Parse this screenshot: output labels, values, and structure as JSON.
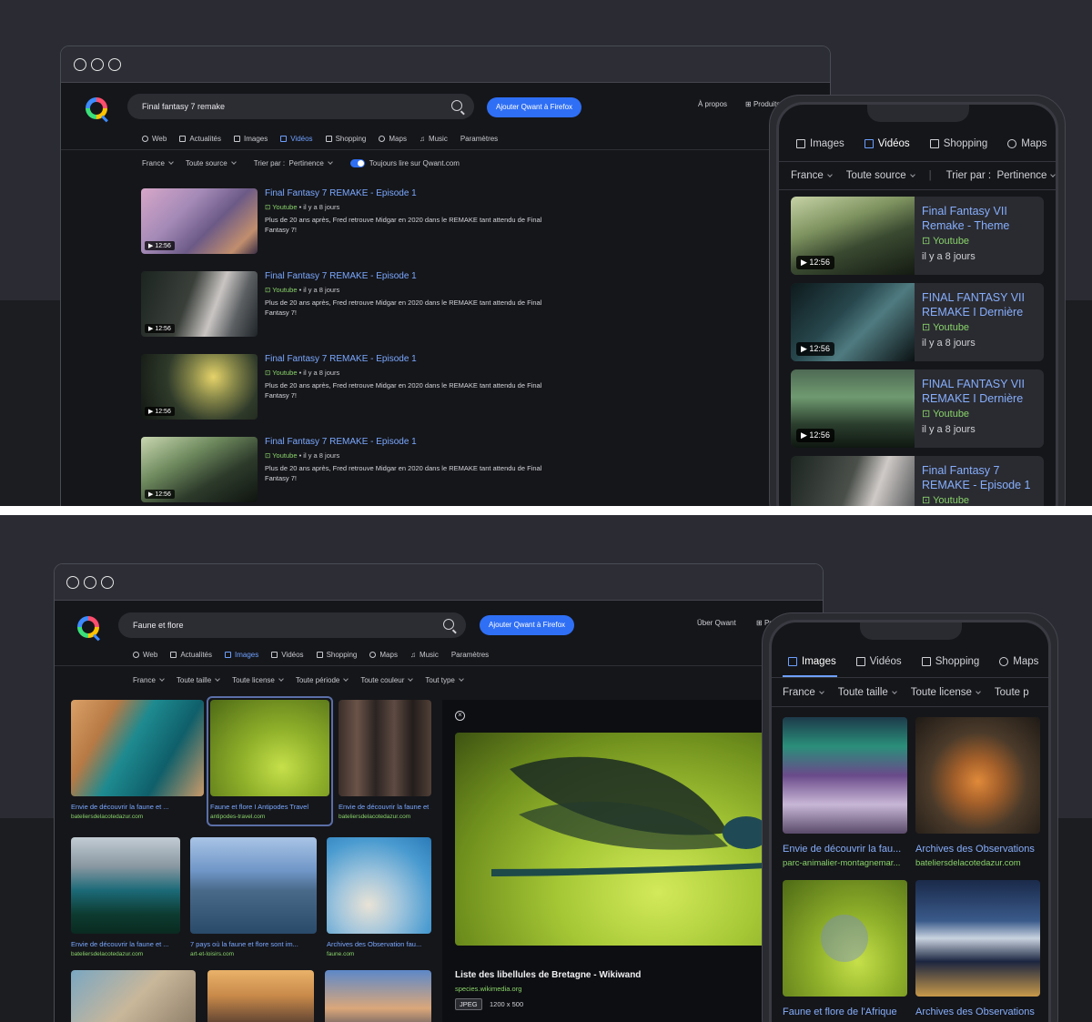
{
  "top": {
    "search": {
      "query": "Final fantasy 7 remake"
    },
    "firefox_button": "Ajouter Qwant à Firefox",
    "links": {
      "about": "À propos",
      "products": "Produits"
    },
    "tabs": [
      "Web",
      "Actualités",
      "Images",
      "Vidéos",
      "Shopping",
      "Maps",
      "Music",
      "Paramètres"
    ],
    "active_tab": "Vidéos",
    "filters": {
      "region": "France",
      "source": "Toute source",
      "sort_label": "Trier par :",
      "sort_value": "Pertinence",
      "toggle_label": "Toujours lire sur Qwant.com"
    },
    "results": [
      {
        "title": "Final Fantasy 7 REMAKE - Episode 1",
        "source": "Youtube",
        "meta": " • il y a 8 jours",
        "desc": "Plus de 20 ans après, Fred retrouve Midgar en 2020 dans le REMAKE tant attendu de Final Fantasy 7!",
        "duration": "▶ 12:56"
      },
      {
        "title": "Final Fantasy 7 REMAKE - Episode 1",
        "source": "Youtube",
        "meta": " • il y a 8 jours",
        "desc": "Plus de 20 ans après, Fred retrouve Midgar en 2020 dans le REMAKE tant attendu de Final Fantasy 7!",
        "duration": "▶ 12:56"
      },
      {
        "title": "Final Fantasy 7 REMAKE - Episode 1",
        "source": "Youtube",
        "meta": " • il y a 8 jours",
        "desc": "Plus de 20 ans après, Fred retrouve Midgar en 2020 dans le REMAKE tant attendu de Final Fantasy 7!",
        "duration": "▶ 12:56"
      },
      {
        "title": "Final Fantasy 7 REMAKE - Episode 1",
        "source": "Youtube",
        "meta": " • il y a 8 jours",
        "desc": "Plus de 20 ans après, Fred retrouve Midgar en 2020 dans le REMAKE tant attendu de Final Fantasy 7!",
        "duration": "▶ 12:56"
      }
    ],
    "phone": {
      "tabs": [
        "Images",
        "Vidéos",
        "Shopping",
        "Maps"
      ],
      "active_tab": "Vidéos",
      "filters": {
        "region": "France",
        "source": "Toute source",
        "sort_label": "Trier par :",
        "sort_value": "Pertinence"
      },
      "cards": [
        {
          "title": "Final Fantasy VII Remake - Theme",
          "source": "Youtube",
          "date": "il y a 8 jours",
          "duration": "▶ 12:56"
        },
        {
          "title": "FINAL FANTASY VII REMAKE I Dernière",
          "source": "Youtube",
          "date": "il y a 8 jours",
          "duration": "▶ 12:56"
        },
        {
          "title": "FINAL FANTASY VII REMAKE I Dernière",
          "source": "Youtube",
          "date": "il y a 8 jours",
          "duration": "▶ 12:56"
        },
        {
          "title": "Final Fantasy 7 REMAKE - Episode 1",
          "source": "Youtube",
          "date": "",
          "duration": ""
        }
      ]
    }
  },
  "bottom": {
    "search": {
      "query": "Faune et flore"
    },
    "firefox_button": "Ajouter Qwant à Firefox",
    "links": {
      "about": "Über Qwant",
      "products": "Pr"
    },
    "tabs": [
      "Web",
      "Actualités",
      "Images",
      "Vidéos",
      "Shopping",
      "Maps",
      "Music",
      "Paramètres"
    ],
    "active_tab": "Images",
    "filters": [
      "France",
      "Toute taille",
      "Toute license",
      "Toute période",
      "Toute couleur",
      "Tout type"
    ],
    "images": [
      {
        "caption": "Envie de découvrir la faune et ...",
        "domain": "bateliersdelacotedazur.com"
      },
      {
        "caption": "Faune et flore I Antipodes Travel",
        "domain": "antipodes-travel.com"
      },
      {
        "caption": "Envie de découvrir la faune et ...",
        "domain": "bateliersdelacotedazur.com"
      },
      {
        "caption": "Envie de découvrir la faune et ...",
        "domain": "bateliersdelacotedazur.com"
      },
      {
        "caption": "7 pays où la faune et flore sont im...",
        "domain": "art-et-loisirs.com"
      },
      {
        "caption": "Archives des Observation fau...",
        "domain": "faune.com"
      }
    ],
    "preview": {
      "title": "Liste des libellules de Bretagne - Wikiwand",
      "domain": "species.wikimedia.org",
      "format": "JPEG",
      "size": "1200 x 500"
    },
    "phone": {
      "tabs": [
        "Images",
        "Vidéos",
        "Shopping",
        "Maps"
      ],
      "active_tab": "Images",
      "filters": [
        "France",
        "Toute taille",
        "Toute license",
        "Toute p"
      ],
      "images": [
        {
          "caption": "Envie de découvrir la fau...",
          "domain": "parc-animalier-montagnemar..."
        },
        {
          "caption": "Archives des Observations",
          "domain": "bateliersdelacotedazur.com"
        },
        {
          "caption": "Faune et flore de l'Afrique",
          "domain": ""
        },
        {
          "caption": "Archives des Observations",
          "domain": ""
        }
      ]
    }
  },
  "colors": {
    "accent": "#2f6ff5",
    "link": "#7aa8ff",
    "source_green": "#89d36a",
    "page_bg": "#2b2c33",
    "browser_bg": "#15161a"
  }
}
